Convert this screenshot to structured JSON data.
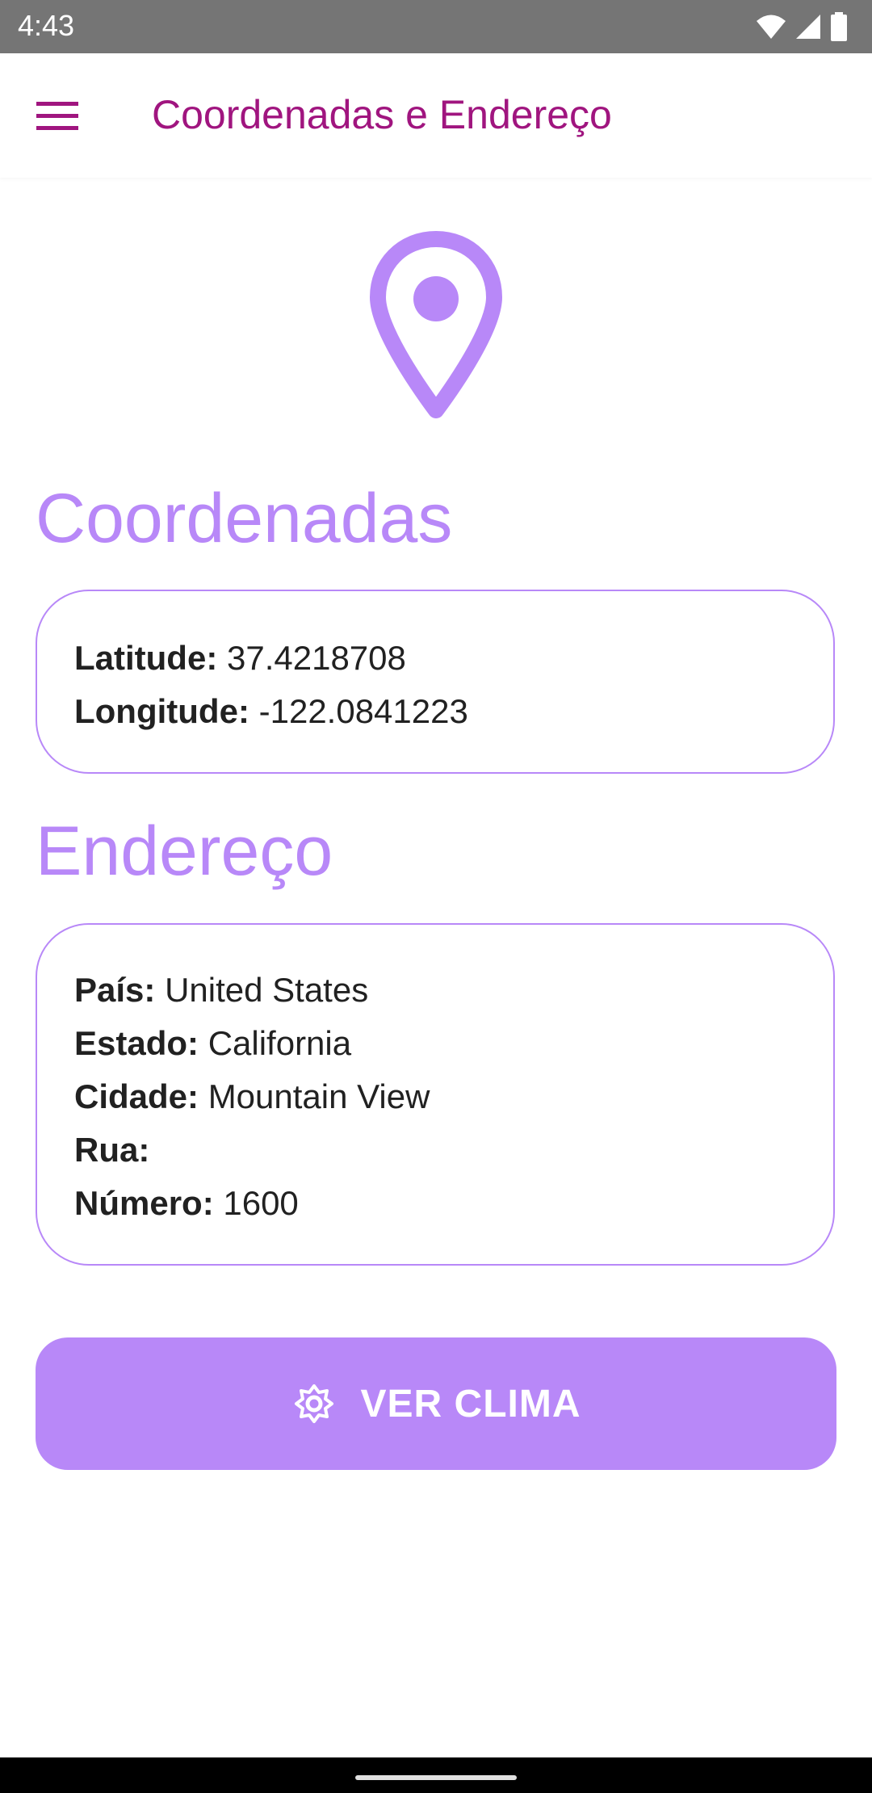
{
  "status_bar": {
    "time": "4:43"
  },
  "app_bar": {
    "title": "Coordenadas e Endereço",
    "menu_icon": "hamburger-menu-icon"
  },
  "colors": {
    "accent": "#b888f8",
    "title": "#a0157f"
  },
  "coordinates": {
    "heading": "Coordenadas",
    "latitude_label": "Latitude:",
    "latitude_value": "37.4218708",
    "longitude_label": "Longitude:",
    "longitude_value": "-122.0841223"
  },
  "address": {
    "heading": "Endereço",
    "country_label": "País:",
    "country_value": "United States",
    "state_label": "Estado:",
    "state_value": "California",
    "city_label": "Cidade:",
    "city_value": "Mountain View",
    "street_label": "Rua:",
    "street_value": "",
    "number_label": "Número:",
    "number_value": "1600"
  },
  "weather_button": {
    "label": "VER CLIMA",
    "icon": "sun-icon"
  }
}
